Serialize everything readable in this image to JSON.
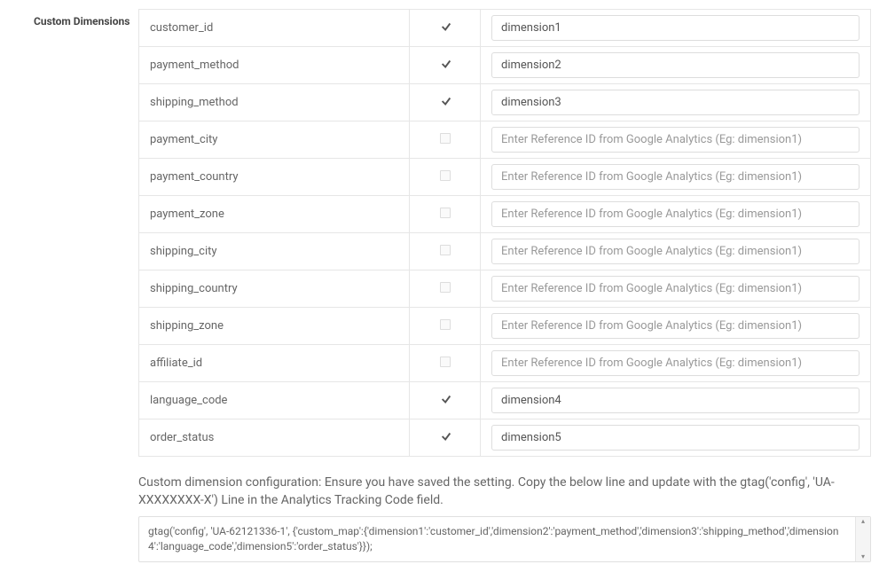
{
  "section_label": "Custom Dimensions",
  "placeholder_text": "Enter Reference ID from Google Analytics (Eg: dimension1)",
  "rows": [
    {
      "name": "customer_id",
      "checked": true,
      "value": "dimension1"
    },
    {
      "name": "payment_method",
      "checked": true,
      "value": "dimension2"
    },
    {
      "name": "shipping_method",
      "checked": true,
      "value": "dimension3"
    },
    {
      "name": "payment_city",
      "checked": false,
      "value": ""
    },
    {
      "name": "payment_country",
      "checked": false,
      "value": ""
    },
    {
      "name": "payment_zone",
      "checked": false,
      "value": ""
    },
    {
      "name": "shipping_city",
      "checked": false,
      "value": ""
    },
    {
      "name": "shipping_country",
      "checked": false,
      "value": ""
    },
    {
      "name": "shipping_zone",
      "checked": false,
      "value": ""
    },
    {
      "name": "affiliate_id",
      "checked": false,
      "value": ""
    },
    {
      "name": "language_code",
      "checked": true,
      "value": "dimension4"
    },
    {
      "name": "order_status",
      "checked": true,
      "value": "dimension5"
    }
  ],
  "help_text": "Custom dimension configuration: Ensure you have saved the setting. Copy the below line and update with the gtag('config', 'UA-XXXXXXXX-X') Line in the Analytics Tracking Code field.",
  "code_text": "gtag('config', 'UA-62121336-1', {'custom_map':{'dimension1':'customer_id','dimension2':'payment_method','dimension3':'shipping_method','dimension4':'language_code','dimension5':'order_status'}});"
}
